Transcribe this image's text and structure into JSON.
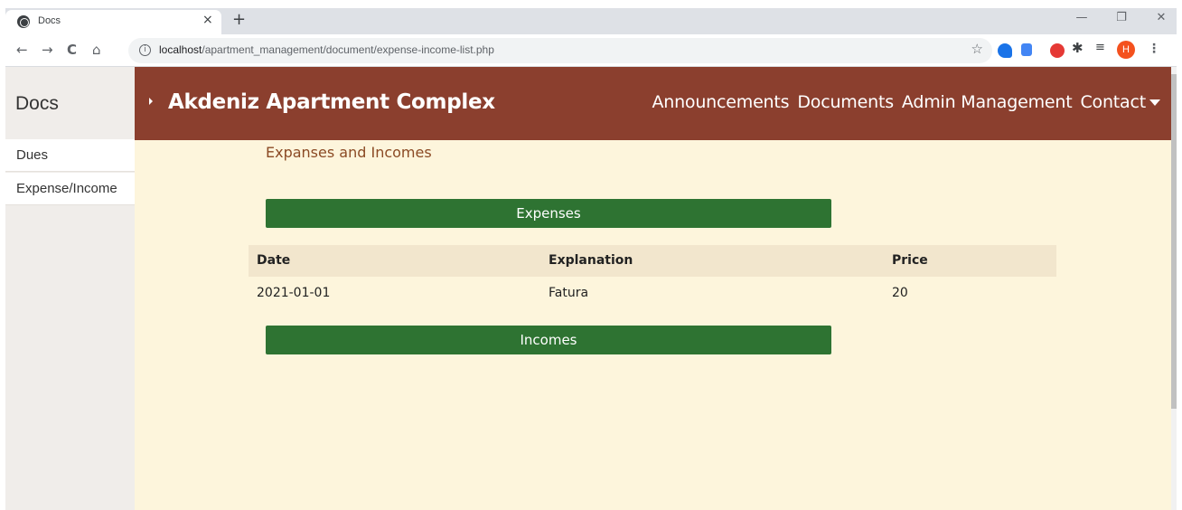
{
  "browser": {
    "tab_title": "Docs",
    "tab_close": "×",
    "new_tab": "+",
    "win_minimize": "—",
    "win_restore": "❐",
    "win_close": "✕",
    "back": "←",
    "forward": "→",
    "reload": "C",
    "home": "⌂",
    "info_glyph": "i",
    "url_host": "localhost",
    "url_path": "/apartment_management/document/expense-income-list.php",
    "star": "☆",
    "puzzle": "✱",
    "queue": "≡",
    "profile_initial": "H",
    "menu": "⋮"
  },
  "sidebar": {
    "title": "Docs",
    "items": [
      {
        "label": "Dues"
      },
      {
        "label": "Expense/Income"
      }
    ]
  },
  "navbar": {
    "brand": "Akdeniz Apartment Complex",
    "links": [
      {
        "label": "Announcements"
      },
      {
        "label": "Documents"
      },
      {
        "label": "Admin Management"
      },
      {
        "label": "Contact"
      }
    ]
  },
  "main": {
    "heading": "Expanses and Incomes",
    "expenses_label": "Expenses",
    "incomes_label": "Incomes",
    "table": {
      "headers": [
        "Date",
        "Explanation",
        "Price"
      ],
      "rows": [
        [
          "2021-01-01",
          "Fatura",
          "20"
        ]
      ]
    }
  },
  "colors": {
    "navbar": "#8b3f2e",
    "page_bg": "#fdf5dc",
    "section_bar": "#2e7332",
    "table_header": "#f2e6cd",
    "heading": "#8b4a24"
  }
}
